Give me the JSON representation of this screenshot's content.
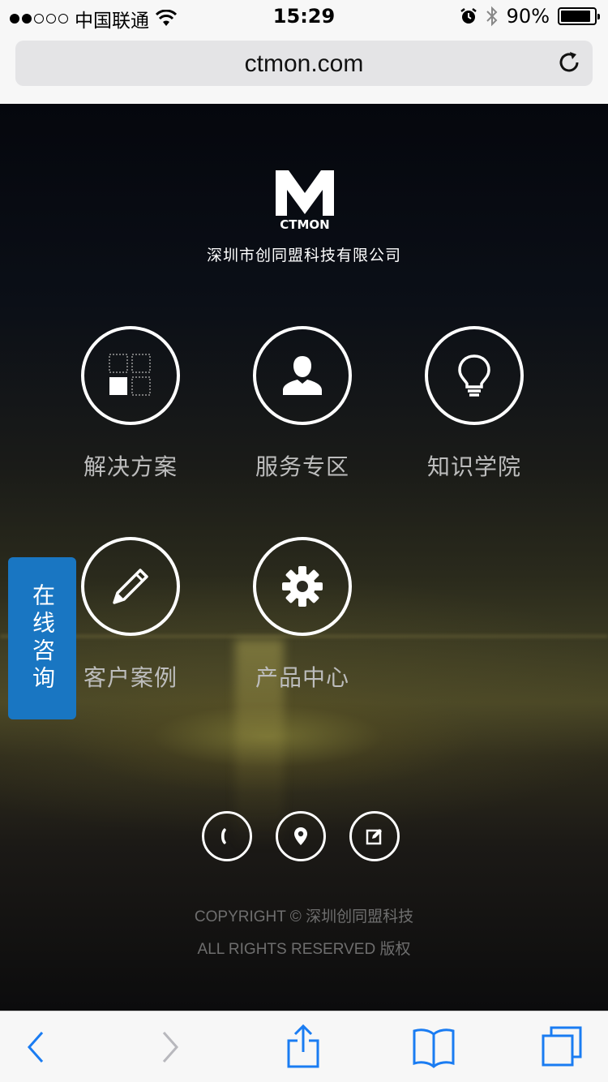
{
  "status_bar": {
    "signal_dots_filled": 2,
    "signal_dots_total": 5,
    "carrier": "中国联通",
    "time": "15:29",
    "battery_percent": "90%",
    "battery_level": 0.9
  },
  "browser": {
    "url": "ctmon.com",
    "reload_icon": "reload-icon"
  },
  "page": {
    "logo_text": "CTMON",
    "company_name": "深圳市创同盟科技有限公司",
    "menu": [
      {
        "label": "解决方案",
        "icon": "solutions-grid-icon"
      },
      {
        "label": "服务专区",
        "icon": "user-icon"
      },
      {
        "label": "知识学院",
        "icon": "lightbulb-icon"
      },
      {
        "label": "客户案例",
        "icon": "pencil-icon"
      },
      {
        "label": "产品中心",
        "icon": "gear-icon"
      }
    ],
    "consult_label": "在线咨询",
    "contact_icons": [
      "phone-icon",
      "location-pin-icon",
      "edit-icon"
    ],
    "copyright_line1": "COPYRIGHT © 深圳创同盟科技",
    "copyright_line2": "ALL RIGHTS RESERVED 版权"
  },
  "toolbar": {
    "items": [
      "back-icon",
      "forward-icon",
      "share-icon",
      "bookmarks-icon",
      "tabs-icon"
    ],
    "accent": "#1a7cf2",
    "disabled": "#b8b8bd"
  },
  "colors": {
    "consult_bg": "#1976c2",
    "menu_label": "#bdbdbd"
  }
}
